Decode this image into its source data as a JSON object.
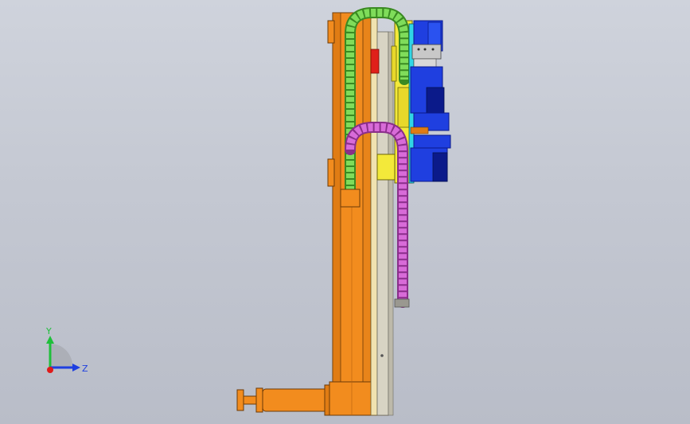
{
  "viewport": {
    "background_top": "#cfd3dc",
    "background_bottom": "#b9bdc8"
  },
  "model": {
    "colors": {
      "column": "#f28c1e",
      "column_dark": "#c56a10",
      "rail": "#d8d4c4",
      "carriage": "#f3e93a",
      "cable_chain_upper": "#7fdc5a",
      "cable_chain_lower": "#d86bd8",
      "gripper_blue": "#1f3fe0",
      "gripper_dark": "#0b1a8a",
      "accent_red": "#e0201a",
      "cyan": "#30d6e6"
    },
    "icons": [
      "coordinate-triad-icon"
    ]
  },
  "triad": {
    "y_label": "Y",
    "z_label": "Z",
    "y_color": "#1fbf3a",
    "z_color": "#1e3fe0",
    "x_color": "#e01a1a"
  }
}
